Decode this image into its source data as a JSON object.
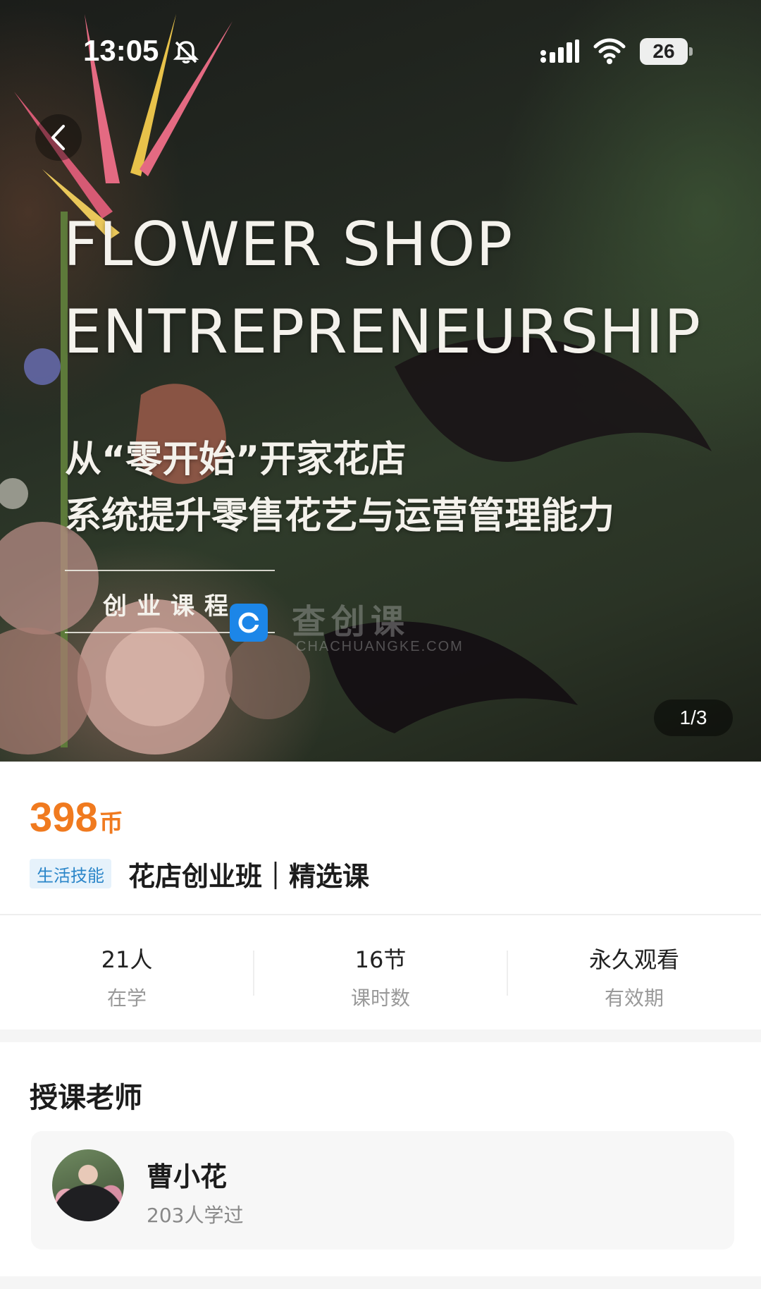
{
  "status_bar": {
    "time": "13:05",
    "battery": "26",
    "icons": [
      "bell-slash-icon",
      "signal-icon",
      "wifi-icon",
      "battery-icon"
    ]
  },
  "hero": {
    "back_icon": "chevron-left-icon",
    "title_line_1": "FLOWER SHOP",
    "title_line_2": "ENTREPRENEURSHIP",
    "subtitle_line_1": "从“零开始”开家花店",
    "subtitle_line_2": "系统提升零售花艺与运营管理能力",
    "tag": "创业课程",
    "watermark_text": "查创课",
    "watermark_url": "CHACHUANGKE.COM",
    "image_counter": "1/3"
  },
  "course": {
    "price": "398",
    "price_unit": "币",
    "category": "生活技能",
    "title": "花店创业班｜精选课",
    "accent_color": "#f07a1f",
    "badge_color": "#2b86c9"
  },
  "stats": [
    {
      "value": "21人",
      "label": "在学"
    },
    {
      "value": "16节",
      "label": "课时数"
    },
    {
      "value": "永久观看",
      "label": "有效期"
    }
  ],
  "teacher": {
    "section_title": "授课老师",
    "name": "曹小花",
    "learners": "203人学过"
  }
}
